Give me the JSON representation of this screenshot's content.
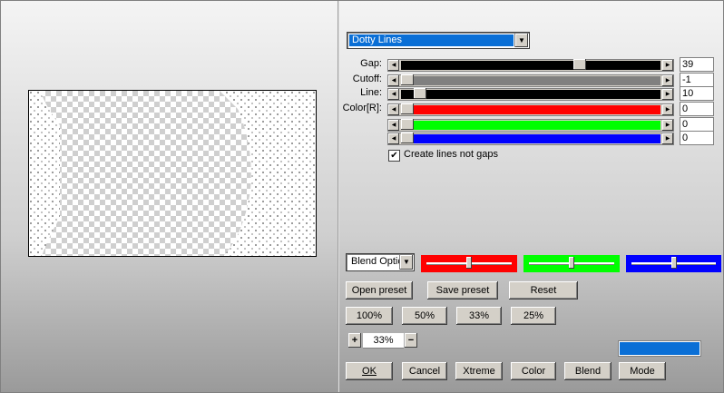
{
  "filter": {
    "selected": "Dotty Lines"
  },
  "sliders": [
    {
      "label": "Gap:",
      "value": "39",
      "fraction": 0.7,
      "fill": "#000000",
      "fill_right": true
    },
    {
      "label": "Cutoff:",
      "value": "-1",
      "fraction": 0.0,
      "fill": "#808080",
      "fill_right": true
    },
    {
      "label": "Line:",
      "value": "10",
      "fraction": 0.05,
      "fill": "#000000",
      "fill_right": true
    },
    {
      "label": "Color[R]:",
      "value": "0",
      "fraction": 0.0,
      "fill": "#ff0000",
      "fill_right": true
    },
    {
      "label": "",
      "value": "0",
      "fraction": 0.0,
      "fill": "#00ff00",
      "fill_right": true
    },
    {
      "label": "",
      "value": "0",
      "fraction": 0.0,
      "fill": "#0000ff",
      "fill_right": true
    }
  ],
  "checkbox": {
    "label": "Create lines not gaps",
    "checked": true
  },
  "blend": {
    "selected": "Blend Optic",
    "red_fraction": 0.5,
    "green_fraction": 0.5,
    "blue_fraction": 0.5,
    "colors": {
      "red": "#ff0000",
      "green": "#00ff00",
      "blue": "#0000ff"
    }
  },
  "preset_buttons": {
    "open": "Open preset",
    "save": "Save preset",
    "reset": "Reset"
  },
  "zoom_buttons": [
    "100%",
    "50%",
    "33%",
    "25%"
  ],
  "zoom": {
    "plus": "+",
    "value": "33%",
    "minus": "−"
  },
  "swatch_color": "#0a6fd6",
  "bottom_buttons": {
    "ok": "OK",
    "cancel": "Cancel",
    "xtreme": "Xtreme",
    "color": "Color",
    "blend": "Blend",
    "mode": "Mode"
  }
}
